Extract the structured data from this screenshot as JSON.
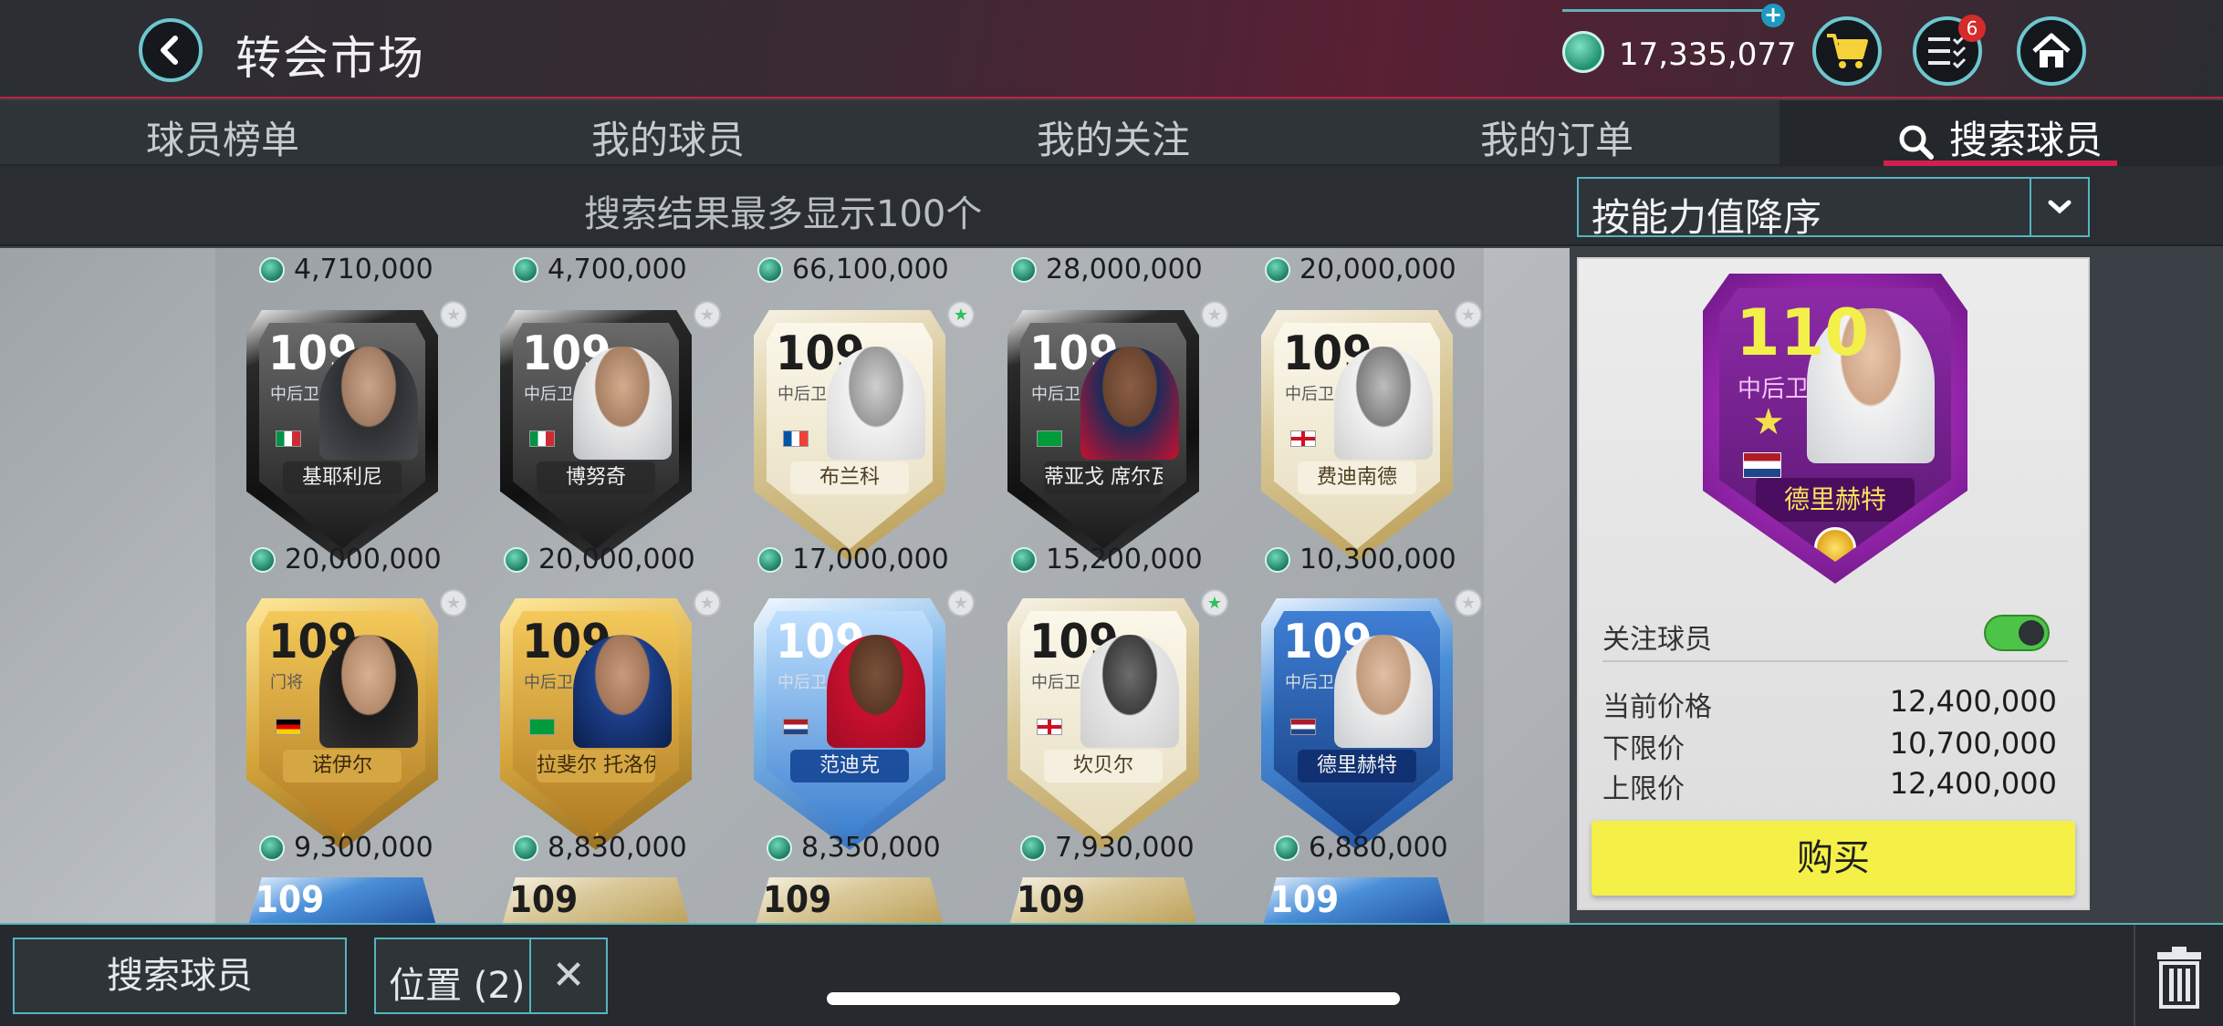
{
  "header": {
    "title": "转会市场",
    "coins": "17,335,077",
    "tasks_badge": "6"
  },
  "tabs": [
    {
      "label": "球员榜单"
    },
    {
      "label": "我的球员"
    },
    {
      "label": "我的关注"
    },
    {
      "label": "我的订单"
    },
    {
      "label": "搜索球员",
      "active": true
    }
  ],
  "filter": {
    "limit_text": "搜索结果最多显示100个",
    "sort_selected": "按能力值降序"
  },
  "grid": {
    "top_prices": [
      "4,710,000",
      "4,700,000",
      "66,100,000",
      "28,000,000",
      "20,000,000"
    ],
    "rows": [
      {
        "cards": [
          {
            "rating": "109",
            "position": "中后卫",
            "name": "基耶利尼",
            "style": "black",
            "price": "20,000,000",
            "followed": false
          },
          {
            "rating": "109",
            "position": "中后卫",
            "name": "博努奇",
            "style": "black",
            "price": "20,000,000",
            "followed": false
          },
          {
            "rating": "109",
            "position": "中后卫",
            "name": "布兰科",
            "style": "icon",
            "price": "17,000,000",
            "followed": true
          },
          {
            "rating": "109",
            "position": "中后卫",
            "name": "蒂亚戈 席尔瓦",
            "style": "black",
            "price": "15,200,000",
            "followed": false
          },
          {
            "rating": "109",
            "position": "中后卫",
            "name": "费迪南德",
            "style": "icon",
            "price": "10,300,000",
            "followed": false
          }
        ]
      },
      {
        "cards": [
          {
            "rating": "109",
            "position": "门将",
            "name": "诺伊尔",
            "style": "gold",
            "price": "9,300,000",
            "followed": false
          },
          {
            "rating": "109",
            "position": "中后卫",
            "name": "拉斐尔 托洛伊",
            "style": "gold",
            "price": "8,830,000",
            "followed": false
          },
          {
            "rating": "109",
            "position": "中后卫",
            "name": "范迪克",
            "style": "ice",
            "price": "8,350,000",
            "followed": false
          },
          {
            "rating": "109",
            "position": "中后卫",
            "name": "坎贝尔",
            "style": "icon",
            "price": "7,930,000",
            "followed": true
          },
          {
            "rating": "109",
            "position": "中后卫",
            "name": "德里赫特",
            "style": "blue",
            "price": "6,880,000",
            "followed": false
          }
        ]
      }
    ],
    "partial_ratings": [
      "109",
      "109",
      "109",
      "109",
      "109"
    ]
  },
  "detail": {
    "rating": "110",
    "position": "中后卫",
    "name": "德里赫特",
    "follow_label": "关注球员",
    "follow_on": true,
    "current_price_label": "当前价格",
    "current_price": "12,400,000",
    "min_price_label": "下限价",
    "min_price": "10,700,000",
    "max_price_label": "上限价",
    "max_price": "12,400,000",
    "buy_label": "购买"
  },
  "bottom": {
    "search_label": "搜索球员",
    "position_filter": "位置 (2)",
    "clear_symbol": "✕"
  },
  "colors": {
    "accent_teal": "#56b4c0",
    "accent_red": "#d31f4f",
    "buy_yellow": "#f4f047",
    "toggle_green": "#4cc447"
  }
}
